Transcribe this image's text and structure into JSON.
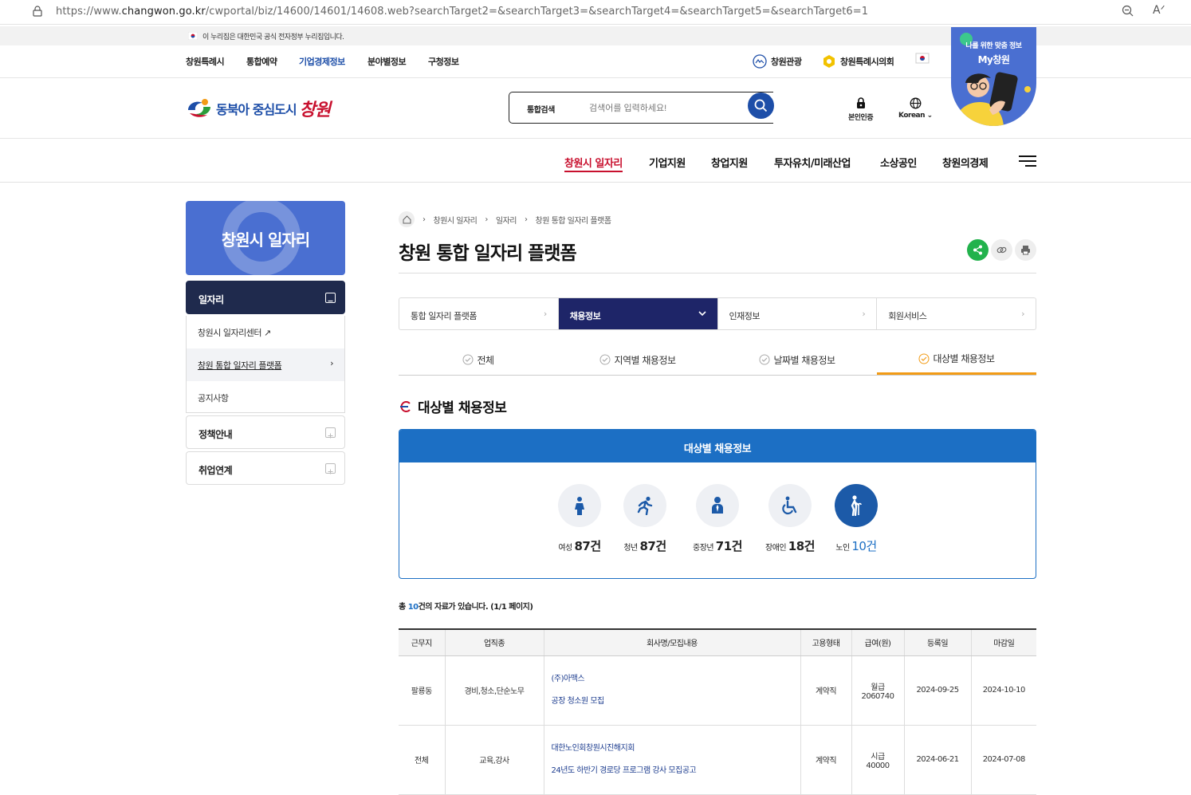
{
  "browser": {
    "url_prefix": "https://www.",
    "url_domain": "changwon.go.kr",
    "url_path": "/cwportal/biz/14600/14601/14608.web?searchTarget2=&searchTarget3=&searchTarget4=&searchTarget5=&searchTarget6=1"
  },
  "gov_banner": "이 누리집은 대한민국 공식 전자정부 누리집입니다.",
  "util_nav": [
    "창원특례시",
    "통합예약",
    "기업경제정보",
    "분야별정보",
    "구청정보"
  ],
  "util_right": [
    "창원관광",
    "창원특례시의회"
  ],
  "logo": {
    "text": "동북아 중심도시",
    "city": "창원"
  },
  "search": {
    "label": "통합검색",
    "placeholder": "검색어를 입력하세요!"
  },
  "header_icons": {
    "auth": "본인인증",
    "lang": "Korean"
  },
  "promo": {
    "line1": "나를 위한 맞춤 정보",
    "line2": "My창원"
  },
  "gnb": [
    "창원시 일자리",
    "기업지원",
    "창업지원",
    "투자유치/미래산업",
    "소상공인",
    "창원의경제"
  ],
  "lnb": {
    "title": "창원시 일자리",
    "section1": "일자리",
    "items": [
      "창원시 일자리센터",
      "창원 통합 일자리 플랫폼",
      "공지사항"
    ],
    "section2": "정책안내",
    "section3": "취업연계"
  },
  "breadcrumb": [
    "창원시 일자리",
    "일자리",
    "창원 통합 일자리 플랫폼"
  ],
  "page_title": "창원 통합 일자리 플랫폼",
  "tabs": [
    "통합 일자리 플랫폼",
    "채용정보",
    "인재정보",
    "회원서비스"
  ],
  "subtabs": [
    "전체",
    "지역별 채용정보",
    "날짜별 채용정보",
    "대상별 채용정보"
  ],
  "section_title": "대상별 채용정보",
  "box_title": "대상별 채용정보",
  "categories": [
    {
      "label": "여성",
      "count": "87건"
    },
    {
      "label": "청년",
      "count": "87건"
    },
    {
      "label": "중장년",
      "count": "71건"
    },
    {
      "label": "장애인",
      "count": "18건"
    },
    {
      "label": "노인",
      "count": "10건"
    }
  ],
  "total": {
    "pre": "총 ",
    "count": "10",
    "post": "건의 자료가 있습니다. (1/1 페이지)"
  },
  "table": {
    "headers": [
      "근무지",
      "업직종",
      "회사명/모집내용",
      "고용형태",
      "급여(원)",
      "등록일",
      "마감일"
    ],
    "rows": [
      {
        "loc": "팔룡동",
        "job": "경비,청소,단순노무",
        "company": "(주)아맥스",
        "title": "공장 청소원 모집",
        "type": "계약직",
        "pay1": "월급",
        "pay2": "2060740",
        "reg": "2024-09-25",
        "end": "2024-10-10"
      },
      {
        "loc": "전체",
        "job": "교육,강사",
        "company": "대한노인회창원시진해지회",
        "title": "24년도 하반기 경로당 프로그램 강사 모집공고",
        "type": "계약직",
        "pay1": "시급",
        "pay2": "40000",
        "reg": "2024-06-21",
        "end": "2024-07-08"
      }
    ]
  },
  "colors": {
    "brand": "#1d4ea8",
    "accent_red": "#c8102e",
    "box_blue": "#1c6fc4",
    "tab_navy": "#1e2568",
    "tab_orange": "#f29b16"
  }
}
